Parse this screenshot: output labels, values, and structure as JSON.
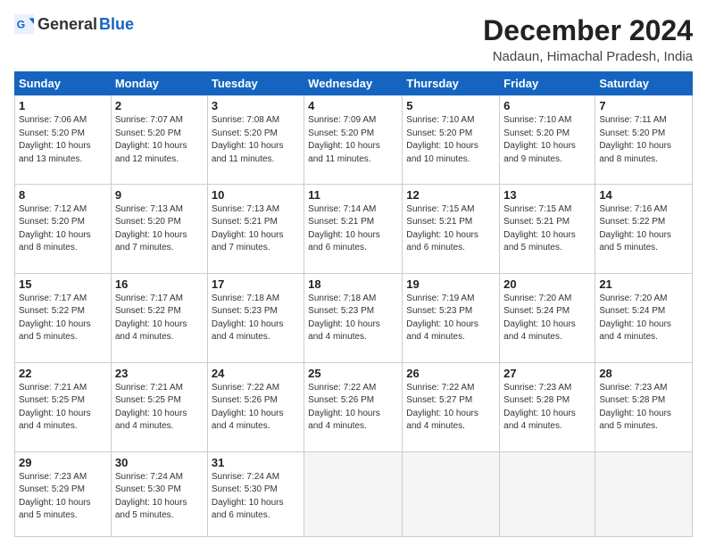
{
  "logo": {
    "general": "General",
    "blue": "Blue"
  },
  "title": "December 2024",
  "location": "Nadaun, Himachal Pradesh, India",
  "days_of_week": [
    "Sunday",
    "Monday",
    "Tuesday",
    "Wednesday",
    "Thursday",
    "Friday",
    "Saturday"
  ],
  "weeks": [
    [
      {
        "day": 1,
        "info": "Sunrise: 7:06 AM\nSunset: 5:20 PM\nDaylight: 10 hours\nand 13 minutes."
      },
      {
        "day": 2,
        "info": "Sunrise: 7:07 AM\nSunset: 5:20 PM\nDaylight: 10 hours\nand 12 minutes."
      },
      {
        "day": 3,
        "info": "Sunrise: 7:08 AM\nSunset: 5:20 PM\nDaylight: 10 hours\nand 11 minutes."
      },
      {
        "day": 4,
        "info": "Sunrise: 7:09 AM\nSunset: 5:20 PM\nDaylight: 10 hours\nand 11 minutes."
      },
      {
        "day": 5,
        "info": "Sunrise: 7:10 AM\nSunset: 5:20 PM\nDaylight: 10 hours\nand 10 minutes."
      },
      {
        "day": 6,
        "info": "Sunrise: 7:10 AM\nSunset: 5:20 PM\nDaylight: 10 hours\nand 9 minutes."
      },
      {
        "day": 7,
        "info": "Sunrise: 7:11 AM\nSunset: 5:20 PM\nDaylight: 10 hours\nand 8 minutes."
      }
    ],
    [
      {
        "day": 8,
        "info": "Sunrise: 7:12 AM\nSunset: 5:20 PM\nDaylight: 10 hours\nand 8 minutes."
      },
      {
        "day": 9,
        "info": "Sunrise: 7:13 AM\nSunset: 5:20 PM\nDaylight: 10 hours\nand 7 minutes."
      },
      {
        "day": 10,
        "info": "Sunrise: 7:13 AM\nSunset: 5:21 PM\nDaylight: 10 hours\nand 7 minutes."
      },
      {
        "day": 11,
        "info": "Sunrise: 7:14 AM\nSunset: 5:21 PM\nDaylight: 10 hours\nand 6 minutes."
      },
      {
        "day": 12,
        "info": "Sunrise: 7:15 AM\nSunset: 5:21 PM\nDaylight: 10 hours\nand 6 minutes."
      },
      {
        "day": 13,
        "info": "Sunrise: 7:15 AM\nSunset: 5:21 PM\nDaylight: 10 hours\nand 5 minutes."
      },
      {
        "day": 14,
        "info": "Sunrise: 7:16 AM\nSunset: 5:22 PM\nDaylight: 10 hours\nand 5 minutes."
      }
    ],
    [
      {
        "day": 15,
        "info": "Sunrise: 7:17 AM\nSunset: 5:22 PM\nDaylight: 10 hours\nand 5 minutes."
      },
      {
        "day": 16,
        "info": "Sunrise: 7:17 AM\nSunset: 5:22 PM\nDaylight: 10 hours\nand 4 minutes."
      },
      {
        "day": 17,
        "info": "Sunrise: 7:18 AM\nSunset: 5:23 PM\nDaylight: 10 hours\nand 4 minutes."
      },
      {
        "day": 18,
        "info": "Sunrise: 7:18 AM\nSunset: 5:23 PM\nDaylight: 10 hours\nand 4 minutes."
      },
      {
        "day": 19,
        "info": "Sunrise: 7:19 AM\nSunset: 5:23 PM\nDaylight: 10 hours\nand 4 minutes."
      },
      {
        "day": 20,
        "info": "Sunrise: 7:20 AM\nSunset: 5:24 PM\nDaylight: 10 hours\nand 4 minutes."
      },
      {
        "day": 21,
        "info": "Sunrise: 7:20 AM\nSunset: 5:24 PM\nDaylight: 10 hours\nand 4 minutes."
      }
    ],
    [
      {
        "day": 22,
        "info": "Sunrise: 7:21 AM\nSunset: 5:25 PM\nDaylight: 10 hours\nand 4 minutes."
      },
      {
        "day": 23,
        "info": "Sunrise: 7:21 AM\nSunset: 5:25 PM\nDaylight: 10 hours\nand 4 minutes."
      },
      {
        "day": 24,
        "info": "Sunrise: 7:22 AM\nSunset: 5:26 PM\nDaylight: 10 hours\nand 4 minutes."
      },
      {
        "day": 25,
        "info": "Sunrise: 7:22 AM\nSunset: 5:26 PM\nDaylight: 10 hours\nand 4 minutes."
      },
      {
        "day": 26,
        "info": "Sunrise: 7:22 AM\nSunset: 5:27 PM\nDaylight: 10 hours\nand 4 minutes."
      },
      {
        "day": 27,
        "info": "Sunrise: 7:23 AM\nSunset: 5:28 PM\nDaylight: 10 hours\nand 4 minutes."
      },
      {
        "day": 28,
        "info": "Sunrise: 7:23 AM\nSunset: 5:28 PM\nDaylight: 10 hours\nand 5 minutes."
      }
    ],
    [
      {
        "day": 29,
        "info": "Sunrise: 7:23 AM\nSunset: 5:29 PM\nDaylight: 10 hours\nand 5 minutes."
      },
      {
        "day": 30,
        "info": "Sunrise: 7:24 AM\nSunset: 5:30 PM\nDaylight: 10 hours\nand 5 minutes."
      },
      {
        "day": 31,
        "info": "Sunrise: 7:24 AM\nSunset: 5:30 PM\nDaylight: 10 hours\nand 6 minutes."
      },
      null,
      null,
      null,
      null
    ]
  ]
}
